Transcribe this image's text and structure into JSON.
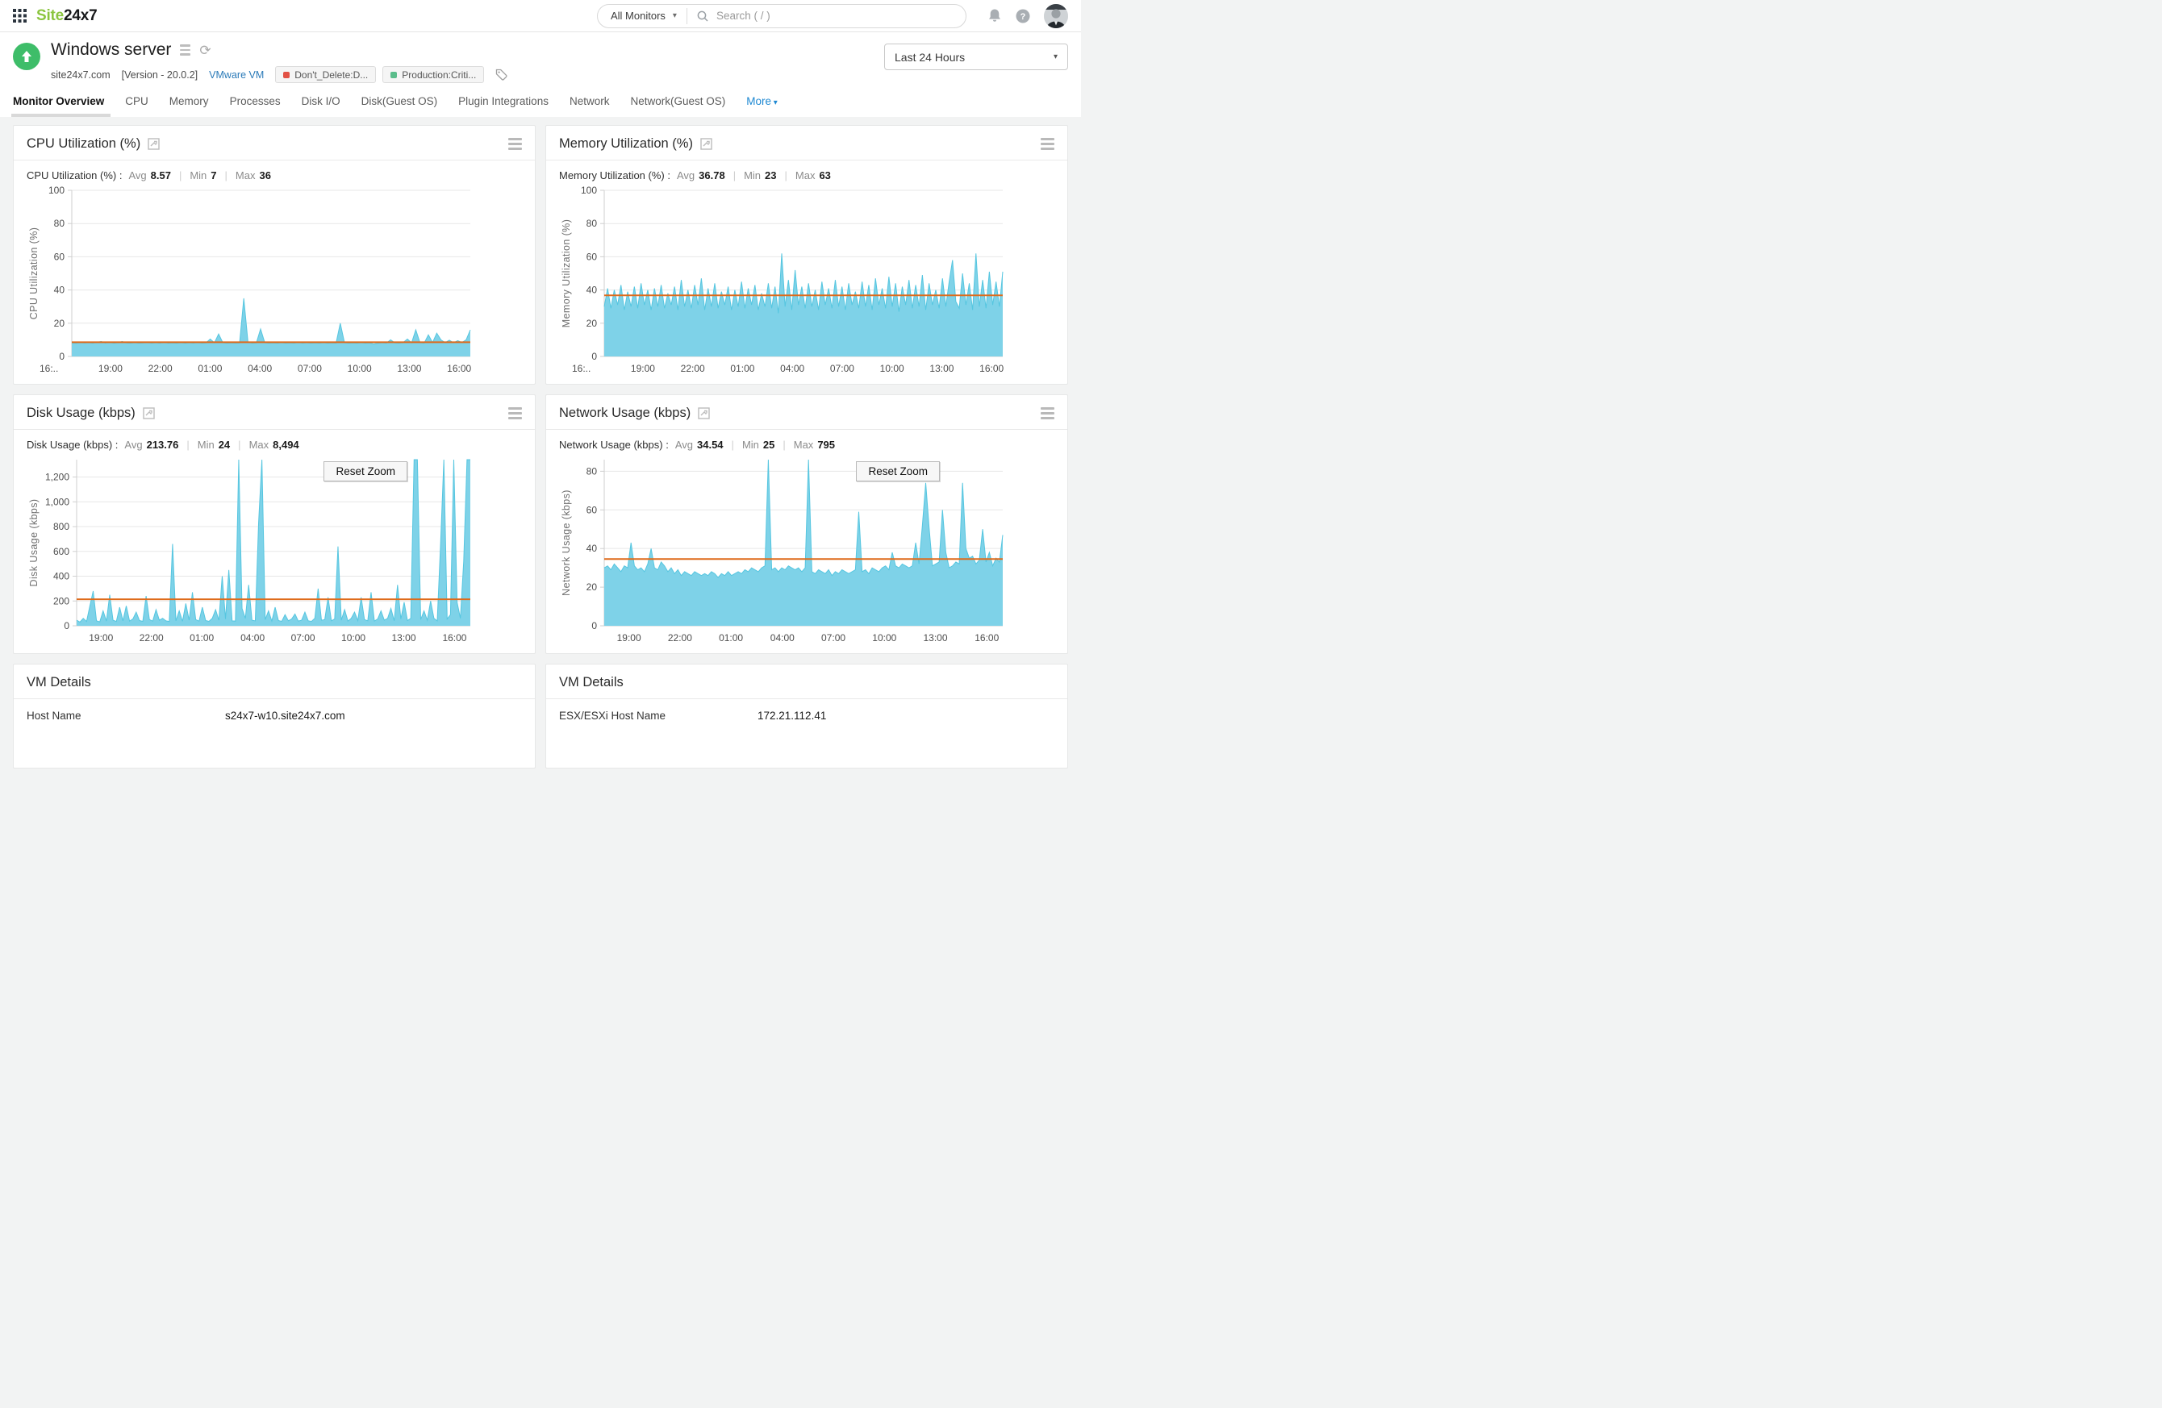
{
  "header": {
    "logo_part1": "Site",
    "logo_part2": "24x7",
    "monitor_scope": "All Monitors",
    "search_placeholder": "Search ( / )"
  },
  "monitor": {
    "title": "Windows server",
    "domain": "site24x7.com",
    "version": "[Version - 20.0.2]",
    "type_link": "VMware VM",
    "tags": [
      {
        "label": "Don't_Delete:D...",
        "color": "#e25145"
      },
      {
        "label": "Production:Criti...",
        "color": "#5abd8b"
      }
    ],
    "time_range": "Last 24 Hours"
  },
  "tabs": [
    {
      "label": "Monitor Overview",
      "active": true
    },
    {
      "label": "CPU"
    },
    {
      "label": "Memory"
    },
    {
      "label": "Processes"
    },
    {
      "label": "Disk I/O"
    },
    {
      "label": "Disk(Guest OS)"
    },
    {
      "label": "Plugin Integrations"
    },
    {
      "label": "Network"
    },
    {
      "label": "Network(Guest OS)"
    },
    {
      "label": "More",
      "more": true
    }
  ],
  "ui": {
    "avg": "Avg",
    "min": "Min",
    "max": "Max",
    "pipe": "|",
    "reset_zoom": "Reset Zoom"
  },
  "colors": {
    "area_fill": "#7ed2e8",
    "area_stroke": "#56c6e0",
    "avg_line": "#df6a1a",
    "grid": "#e7e7e7",
    "axis": "#cfcfcf",
    "tick_text": "#4d4d4d",
    "axis_title": "#707070",
    "status_green": "#3ebd69",
    "logo_green": "#8bc53f",
    "link_blue": "#2a7ab8"
  },
  "chart_data": [
    {
      "type": "area",
      "slug": "cpu-utilization",
      "title": "CPU Utilization (%)",
      "stats_label": "CPU Utilization (%) :",
      "avg": "8.57",
      "min": "7",
      "max": "36",
      "avg_value": 8.57,
      "ylabel": "CPU Utilization (%)",
      "ymax": 100,
      "ytick_values": [
        0,
        20,
        40,
        60,
        80,
        100
      ],
      "ytick_labels": [
        "0",
        "20",
        "40",
        "60",
        "80",
        "100"
      ],
      "left_margin": 56,
      "reset_zoom": false,
      "xticks": [
        [
          "16:..",
          0.0
        ],
        [
          "19:00",
          0.097
        ],
        [
          "22:00",
          0.222
        ],
        [
          "01:00",
          0.347
        ],
        [
          "04:00",
          0.472
        ],
        [
          "07:00",
          0.597
        ],
        [
          "10:00",
          0.722
        ],
        [
          "13:00",
          0.847
        ],
        [
          "16:00",
          0.972
        ]
      ],
      "points": [
        8.2,
        8,
        8.4,
        8.1,
        8.3,
        8,
        8.5,
        9,
        8.1,
        8.6,
        8,
        8.3,
        9,
        8.2,
        8,
        8.4,
        8,
        8.2,
        8.5,
        8,
        8.3,
        8,
        8.6,
        8,
        8.2,
        8,
        8.4,
        8,
        8.3,
        8.1,
        8.5,
        8,
        8.2,
        10.5,
        8.2,
        13.5,
        8.3,
        8,
        8.2,
        8,
        8.1,
        35,
        8.5,
        8,
        8.2,
        16.5,
        8.3,
        8,
        8.2,
        8,
        8.4,
        8,
        8.2,
        8,
        8.5,
        8,
        8.3,
        8,
        8.2,
        8,
        8.4,
        8,
        8.2,
        8,
        20,
        8.3,
        8,
        8.2,
        8,
        8.4,
        8,
        8.2,
        7.5,
        8,
        8.3,
        8,
        10,
        8.2,
        8,
        8.4,
        10.5,
        8.2,
        16,
        8.3,
        8,
        13,
        8.4,
        14,
        10,
        8.3,
        9.8,
        8.2,
        9.5,
        8.4,
        10,
        16
      ]
    },
    {
      "type": "area",
      "slug": "memory-utilization",
      "title": "Memory Utilization (%)",
      "stats_label": "Memory Utilization (%) :",
      "avg": "36.78",
      "min": "23",
      "max": "63",
      "avg_value": 36.78,
      "ylabel": "Memory Utilization (%)",
      "ymax": 100,
      "ytick_values": [
        0,
        20,
        40,
        60,
        80,
        100
      ],
      "ytick_labels": [
        "0",
        "20",
        "40",
        "60",
        "80",
        "100"
      ],
      "left_margin": 56,
      "reset_zoom": false,
      "xticks": [
        [
          "16:..",
          0.0
        ],
        [
          "19:00",
          0.097
        ],
        [
          "22:00",
          0.222
        ],
        [
          "01:00",
          0.347
        ],
        [
          "04:00",
          0.472
        ],
        [
          "07:00",
          0.597
        ],
        [
          "10:00",
          0.722
        ],
        [
          "13:00",
          0.847
        ],
        [
          "16:00",
          0.972
        ]
      ],
      "points": [
        30,
        41,
        29,
        40,
        31,
        43,
        28,
        39,
        30,
        42,
        29,
        44,
        31,
        40,
        28,
        41,
        30,
        43,
        29,
        38,
        31,
        42,
        28,
        46,
        30,
        40,
        29,
        43,
        31,
        47,
        28,
        41,
        30,
        44,
        29,
        39,
        31,
        42,
        28,
        40,
        30,
        45,
        29,
        41,
        31,
        43,
        28,
        38,
        30,
        44,
        29,
        42,
        26,
        62,
        30,
        46,
        28,
        52,
        31,
        42,
        29,
        44,
        30,
        40,
        28,
        45,
        31,
        41,
        29,
        46,
        30,
        42,
        28,
        44,
        31,
        39,
        29,
        45,
        30,
        43,
        28,
        47,
        31,
        41,
        29,
        48,
        30,
        44,
        27,
        42,
        31,
        46,
        29,
        43,
        30,
        49,
        28,
        44,
        31,
        40,
        29,
        47,
        30,
        45,
        58,
        33,
        29,
        50,
        31,
        44,
        28,
        62,
        30,
        46,
        29,
        51,
        31,
        45,
        30,
        51
      ]
    },
    {
      "type": "area",
      "slug": "disk-usage",
      "title": "Disk Usage (kbps)",
      "stats_label": "Disk Usage (kbps) :",
      "avg": "213.76",
      "min": "24",
      "max": "8,494",
      "avg_value": 213.76,
      "ylabel": "Disk Usage (kbps)",
      "ymax": 1340,
      "ytick_values": [
        0,
        200,
        400,
        600,
        800,
        1000,
        1200
      ],
      "ytick_labels": [
        "0",
        "200",
        "400",
        "600",
        "800",
        "1,000",
        "1,200"
      ],
      "left_margin": 62,
      "reset_zoom": true,
      "xticks": [
        [
          "19:00",
          0.062
        ],
        [
          "22:00",
          0.19
        ],
        [
          "01:00",
          0.318
        ],
        [
          "04:00",
          0.447
        ],
        [
          "07:00",
          0.575
        ],
        [
          "10:00",
          0.703
        ],
        [
          "13:00",
          0.831
        ],
        [
          "16:00",
          0.96
        ]
      ],
      "points": [
        45,
        30,
        60,
        35,
        160,
        280,
        40,
        32,
        120,
        38,
        250,
        45,
        35,
        150,
        40,
        160,
        38,
        55,
        110,
        42,
        36,
        240,
        50,
        38,
        130,
        45,
        60,
        40,
        35,
        660,
        40,
        120,
        36,
        180,
        45,
        270,
        50,
        38,
        150,
        42,
        36,
        60,
        130,
        45,
        400,
        55,
        450,
        40,
        38,
        1340,
        140,
        60,
        330,
        45,
        40,
        830,
        1340,
        50,
        120,
        38,
        150,
        42,
        36,
        90,
        40,
        55,
        95,
        38,
        45,
        110,
        40,
        36,
        60,
        300,
        45,
        50,
        230,
        40,
        55,
        640,
        45,
        130,
        38,
        60,
        110,
        42,
        230,
        50,
        40,
        270,
        38,
        55,
        120,
        45,
        60,
        140,
        40,
        330,
        55,
        190,
        42,
        60,
        1340,
        1340,
        50,
        120,
        45,
        200,
        60,
        40,
        650,
        1340,
        55,
        90,
        1340,
        190,
        60,
        520,
        1340,
        1340
      ]
    },
    {
      "type": "area",
      "slug": "network-usage",
      "title": "Network Usage (kbps)",
      "stats_label": "Network Usage (kbps) :",
      "avg": "34.54",
      "min": "25",
      "max": "795",
      "avg_value": 34.54,
      "ylabel": "Network Usage (kbps)",
      "ymax": 86,
      "ytick_values": [
        0,
        20,
        40,
        60,
        80
      ],
      "ytick_labels": [
        "0",
        "20",
        "40",
        "60",
        "80"
      ],
      "left_margin": 56,
      "reset_zoom": true,
      "xticks": [
        [
          "19:00",
          0.062
        ],
        [
          "22:00",
          0.19
        ],
        [
          "01:00",
          0.318
        ],
        [
          "04:00",
          0.447
        ],
        [
          "07:00",
          0.575
        ],
        [
          "10:00",
          0.703
        ],
        [
          "13:00",
          0.831
        ],
        [
          "16:00",
          0.96
        ]
      ],
      "points": [
        30,
        31,
        29,
        32,
        30,
        28,
        31,
        30,
        43,
        31,
        29,
        30,
        28,
        32,
        40,
        30,
        29,
        33,
        31,
        28,
        30,
        27,
        29,
        26,
        28,
        27,
        26,
        28,
        27,
        26,
        27,
        26,
        28,
        27,
        25,
        27,
        26,
        28,
        26,
        27,
        28,
        27,
        29,
        28,
        30,
        29,
        28,
        30,
        31,
        86,
        29,
        30,
        28,
        30,
        29,
        31,
        30,
        29,
        30,
        28,
        30,
        86,
        28,
        27,
        29,
        28,
        27,
        29,
        26,
        28,
        27,
        29,
        28,
        27,
        28,
        29,
        59,
        28,
        29,
        27,
        30,
        29,
        28,
        30,
        31,
        29,
        38,
        31,
        30,
        32,
        31,
        30,
        31,
        43,
        32,
        52,
        74,
        51,
        31,
        32,
        33,
        60,
        38,
        30,
        31,
        33,
        32,
        74,
        40,
        35,
        36,
        32,
        34,
        50,
        33,
        38,
        31,
        35,
        33,
        47
      ]
    }
  ],
  "vm_details": [
    {
      "title": "VM Details",
      "rows": [
        {
          "label": "Host Name",
          "value": "s24x7-w10.site24x7.com"
        }
      ]
    },
    {
      "title": "VM Details",
      "rows": [
        {
          "label": "ESX/ESXi Host Name",
          "value": "172.21.112.41"
        }
      ]
    }
  ]
}
